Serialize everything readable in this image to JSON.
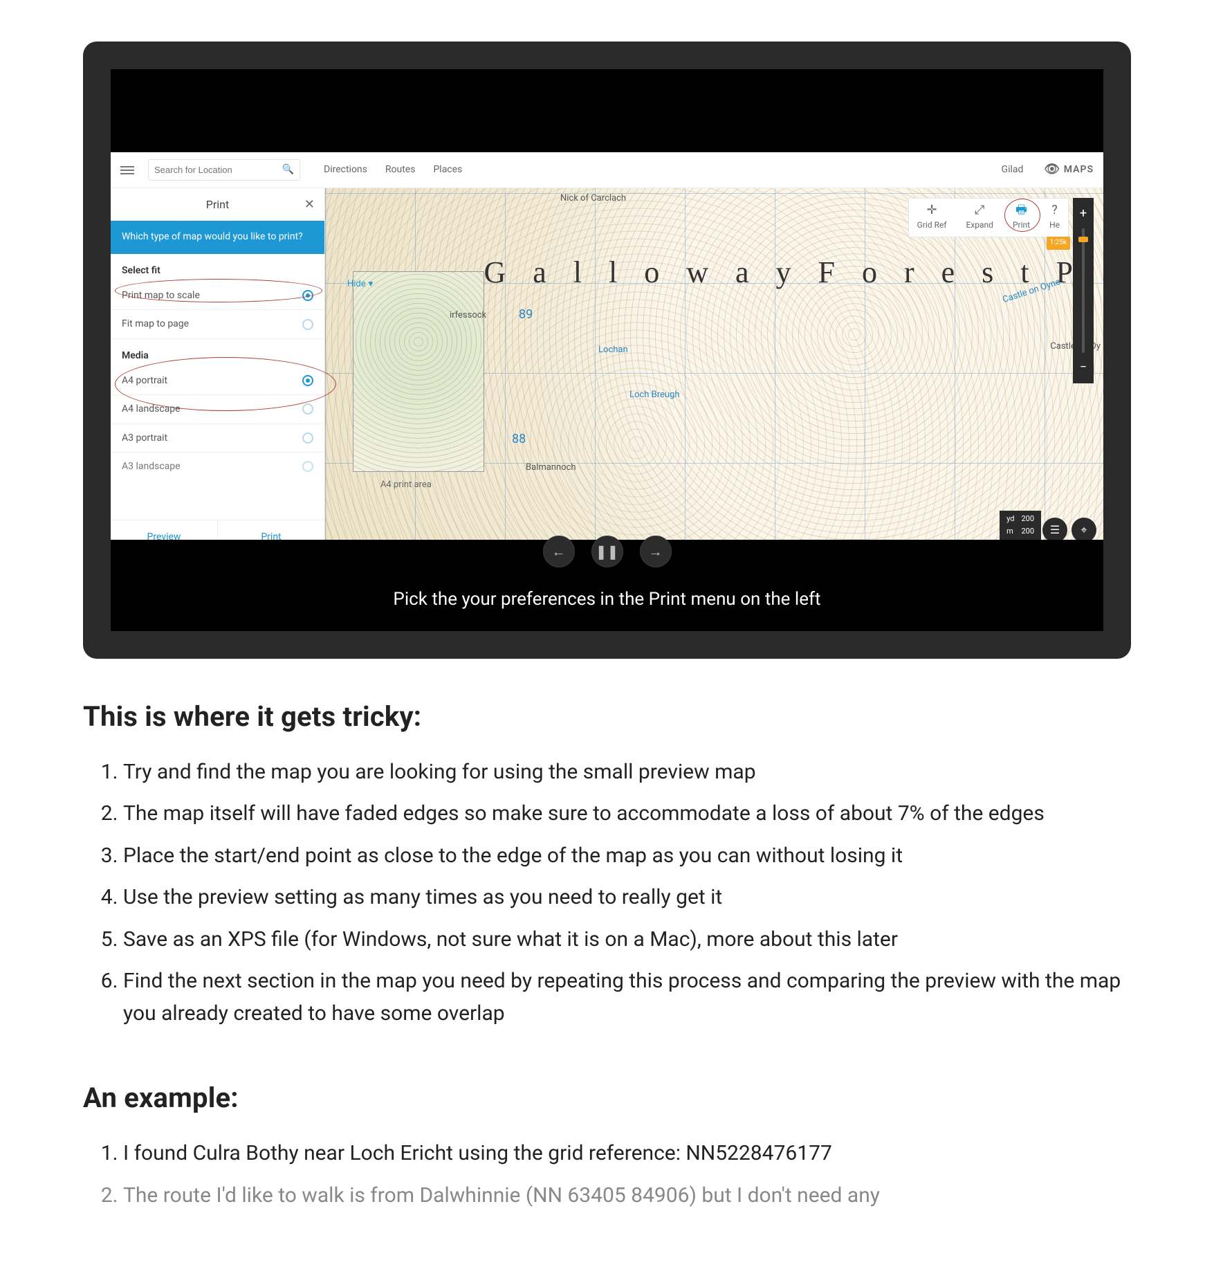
{
  "slideshow": {
    "caption": "Pick the your preferences in the Print menu on the left",
    "controls": {
      "prev": "←",
      "pause": "❚❚",
      "next": "→"
    }
  },
  "map_app": {
    "search_placeholder": "Search for Location",
    "top_links": {
      "directions": "Directions",
      "routes": "Routes",
      "places": "Places"
    },
    "user": "Gilad",
    "brand": "MAPS",
    "panel": {
      "title": "Print",
      "close": "✕",
      "question": "Which type of map would you like to print?",
      "fit_title": "Select fit",
      "fit_options": {
        "scale": "Print map to scale",
        "page": "Fit map to page"
      },
      "media_title": "Media",
      "media_options": {
        "a4p": "A4 portrait",
        "a4l": "A4 landscape",
        "a3p": "A3 portrait",
        "a3l": "A3 landscape"
      },
      "preview": "Preview",
      "print": "Print"
    },
    "map": {
      "title_text": "G a l l o w a y  F o r e s t  P",
      "hide": "Hide",
      "print_area_label": "A4 print area",
      "labels": {
        "nick": "Nick of Carclach",
        "irfessock": "irfessock",
        "balmannoch": "Balmannoch",
        "lochan": "Lochan",
        "loch_breugh": "Loch Breugh",
        "castle_oyne": "Castle on Oyne",
        "castle_oy": "Castle on Oy"
      },
      "grid_89": "89",
      "grid_88": "88",
      "controls": {
        "gridref": "Grid Ref",
        "expand": "Expand",
        "print": "Print",
        "help": "He"
      },
      "badge": "1:25k",
      "scale": {
        "yd": "yd",
        "m": "m",
        "v1": "200",
        "v2": "200"
      }
    }
  },
  "article": {
    "heading1": "This is where it gets tricky:",
    "steps": [
      "Try and find the map you are looking for using the small preview map",
      "The map itself will have faded edges so make sure to accommodate a loss of about 7% of the edges",
      "Place the start/end point as close to the edge of the map as you can without losing it",
      "Use the preview setting as many times as you need to really get it",
      "Save as an XPS file (for Windows, not sure what it is on a Mac), more about this later",
      "Find the next section in the map you need by repeating this process and comparing the preview with the map you already created to have some overlap"
    ],
    "heading2": "An example:",
    "example": [
      "I found Culra Bothy near Loch Ericht using the grid reference: NN5228476177",
      "The route I'd like to walk is from Dalwhinnie (NN 63405 84906) but I don't need any"
    ]
  }
}
